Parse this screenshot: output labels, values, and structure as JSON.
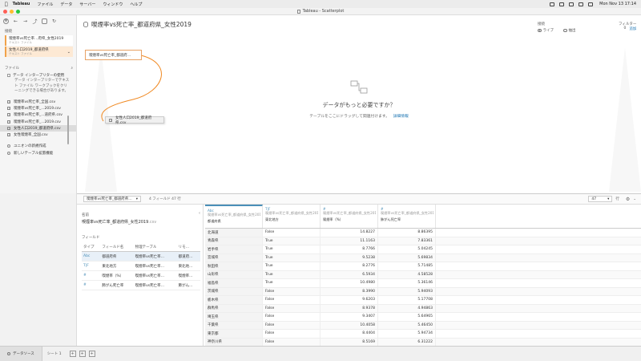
{
  "menubar": {
    "items": [
      "Tableau",
      "ファイル",
      "データ",
      "サーバー",
      "ウィンドウ",
      "ヘルプ"
    ],
    "clock": "Mon Nov 13  17:14"
  },
  "window": {
    "title": "Tableau - Scatterplot"
  },
  "left": {
    "connections_header": "接続",
    "add_label": "追加",
    "connections": [
      {
        "name": "喫煙率vs死亡率…府県_女性2019",
        "type": "テキスト ファイル"
      },
      {
        "name": "女性人口2019_都道府県",
        "type": "テキスト ファイル"
      }
    ],
    "files_header": "ファイル",
    "interpreter_label": "データ インタープリターの使用",
    "interpreter_desc": "データ インタープリターでテキスト ファイル ワークブックをクリーニングできる場合があります。",
    "files": [
      "喫煙率vs死亡率_全国.csv",
      "喫煙率vs死亡率_...2019.csv",
      "喫煙率vs死亡率_...道府県.csv",
      "喫煙率vs死亡率_...2019.csv",
      "女性人口2019_都道府県.csv",
      "女性喫煙率_全国.csv"
    ],
    "union_label": "ユニオンの新規作成",
    "new_table_label": "新しいテーブル拡張機能"
  },
  "canvas": {
    "title": "喫煙率vs死亡率_都道府県_女性2019",
    "connection_label": "接続",
    "live_label": "ライブ",
    "extract_label": "抽出",
    "filters_label": "フィルター",
    "filters_count": "0",
    "filters_add": "追加",
    "table_card": "喫煙率vs死亡率_都道府…",
    "drag_card": "女性人口2019_都道府県.csv",
    "need_more": "データがもっと必要ですか？",
    "drag_hint": "テーブルをここにドラッグして関連付けます。",
    "details_link": "詳細情報"
  },
  "strip": {
    "table_select": "喫煙率vs死亡率_都道府県…",
    "field_count": "4 フィールド 47 行",
    "rows_value": "47",
    "rows_label": "行"
  },
  "meta": {
    "name_header": "名前",
    "name": "喫煙率vs死亡率_都道府県_女性2019",
    "name_ext": ".csv",
    "fields_header": "フィールド",
    "columns": [
      "タイプ",
      "フィールド名",
      "物理テーブル",
      "リモ…"
    ],
    "rows": [
      {
        "type": "Abc",
        "field": "都道府県",
        "table": "喫煙率vs死亡率…",
        "remote": "都道府…"
      },
      {
        "type": "T|F",
        "field": "東北地方",
        "table": "喫煙率vs死亡率…",
        "remote": "東北地…"
      },
      {
        "type": "#",
        "field": "喫煙率（%）",
        "table": "喫煙率vs死亡率…",
        "remote": "喫煙率…"
      },
      {
        "type": "#",
        "field": "肺がん死亡率",
        "table": "喫煙率vs死亡率…",
        "remote": "肺がん…"
      }
    ]
  },
  "grid": {
    "columns": [
      {
        "type": "Abc",
        "source": "喫煙率vs死亡率_都道府県_女性2019…",
        "name": "都道府県"
      },
      {
        "type": "T|F",
        "source": "喫煙率vs死亡率_都道府県_女性2019…",
        "name": "東北地方"
      },
      {
        "type": "#",
        "source": "喫煙率vs死亡率_都道府県_女性2019…",
        "name": "喫煙率（%）"
      },
      {
        "type": "#",
        "source": "喫煙率vs死亡率_都道府県_女性2019…",
        "name": "肺がん死亡率"
      }
    ],
    "rows": [
      [
        "北海道",
        "False",
        "14.8227",
        "8.86395"
      ],
      [
        "青森県",
        "True",
        "11.1163",
        "7.83361"
      ],
      [
        "岩手県",
        "True",
        "8.7766",
        "5.04245"
      ],
      [
        "宮城県",
        "True",
        "9.5238",
        "5.69834"
      ],
      [
        "秋田県",
        "True",
        "8.2776",
        "5.71485"
      ],
      [
        "山形県",
        "True",
        "6.5934",
        "4.58528"
      ],
      [
        "福島県",
        "True",
        "10.4980",
        "5.36146"
      ],
      [
        "茨城県",
        "False",
        "8.3990",
        "5.94093"
      ],
      [
        "栃木県",
        "False",
        "9.6203",
        "5.17708"
      ],
      [
        "群馬県",
        "False",
        "8.9378",
        "4.94863"
      ],
      [
        "埼玉県",
        "False",
        "9.3407",
        "5.64965"
      ],
      [
        "千葉県",
        "False",
        "10.4058",
        "5.46450"
      ],
      [
        "東京都",
        "False",
        "8.4404",
        "5.94734"
      ],
      [
        "神奈川県",
        "False",
        "8.5169",
        "6.31222"
      ]
    ]
  },
  "bottom": {
    "datasource_tab": "データソース",
    "sheet_tab": "シート 1"
  }
}
